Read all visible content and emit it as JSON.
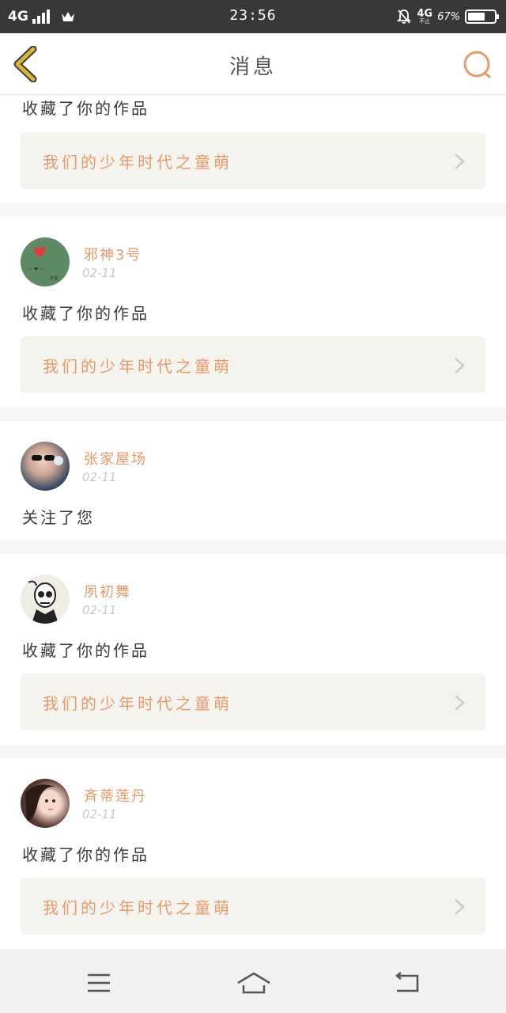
{
  "status": {
    "network": "4G",
    "time": "23:56",
    "network_right": "4G",
    "network_sub": "不止",
    "battery_pct_text": "67%",
    "battery_level": 0.67
  },
  "header": {
    "title": "消息"
  },
  "colors": {
    "accent": "#e69a6a",
    "back": "#d9b43c",
    "card_bg": "#f4f3ee"
  },
  "feed": [
    {
      "action": "收藏了你的作品",
      "work_title": "我们的少年时代之童萌"
    },
    {
      "user": "邪神3号",
      "date": "02-11",
      "action": "收藏了你的作品",
      "work_title": "我们的少年时代之童萌"
    },
    {
      "user": "张家屋场",
      "date": "02-11",
      "action": "关注了您"
    },
    {
      "user": "夙初舞",
      "date": "02-11",
      "action": "收藏了你的作品",
      "work_title": "我们的少年时代之童萌"
    },
    {
      "user": "斉蒂莲丹",
      "date": "02-11",
      "action": "收藏了你的作品",
      "work_title": "我们的少年时代之童萌"
    }
  ],
  "bottom_nav": {
    "menu": "menu-icon",
    "home": "home-icon",
    "back": "back-icon"
  }
}
